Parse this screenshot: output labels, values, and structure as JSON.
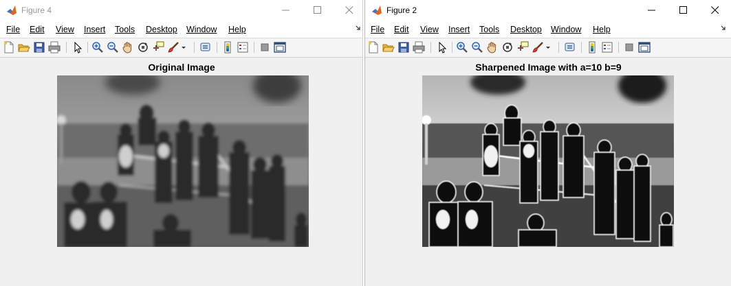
{
  "menu_items": [
    "File",
    "Edit",
    "View",
    "Insert",
    "Tools",
    "Desktop",
    "Window",
    "Help"
  ],
  "icons": {
    "window": [
      "matlab-logo-icon",
      "minimize-icon",
      "maximize-icon",
      "close-icon"
    ],
    "toolbar": [
      "new-figure-icon",
      "open-file-icon",
      "save-icon",
      "print-icon",
      "edit-plot-arrow-icon",
      "zoom-in-icon",
      "zoom-out-icon",
      "pan-hand-icon",
      "rotate-3d-icon",
      "data-cursor-icon",
      "brush-icon",
      "brush-dropdown-arrow-icon",
      "link-plot-icon",
      "colorbar-icon",
      "legend-icon",
      "hide-plot-tools-icon",
      "show-plot-tools-icon"
    ]
  },
  "windows": {
    "left": {
      "title": "Figure 4",
      "plot_title": "Original Image"
    },
    "right": {
      "title": "Figure 2",
      "plot_title": "Sharpened Image with a=10 b=9"
    }
  }
}
